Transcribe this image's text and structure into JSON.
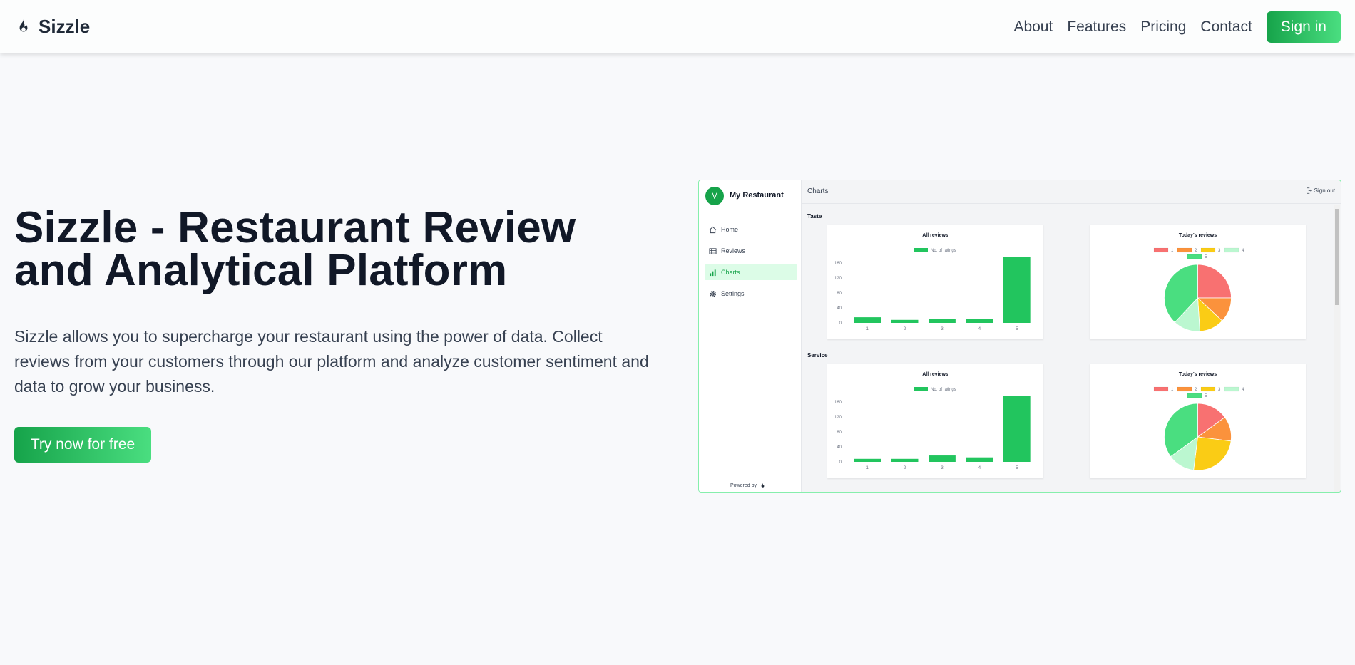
{
  "brand": {
    "name": "Sizzle"
  },
  "nav": {
    "links": [
      "About",
      "Features",
      "Pricing",
      "Contact"
    ],
    "signin_label": "Sign in"
  },
  "hero": {
    "title_line1": "Sizzle - Restaurant Review",
    "title_line2": "and Analytical Platform",
    "description": "Sizzle allows you to supercharge your restaurant using the power of data. Collect reviews from your customers through our platform and analyze customer sentiment and data to grow your business.",
    "cta_label": "Try now for free"
  },
  "preview": {
    "avatar_letter": "M",
    "restaurant_name": "My Restaurant",
    "menu": [
      "Home",
      "Reviews",
      "Charts",
      "Settings"
    ],
    "active_menu": "Charts",
    "powered_by": "Powered by",
    "header_title": "Charts",
    "signout_label": "Sign out",
    "sections": [
      "Taste",
      "Service"
    ],
    "card_titles": {
      "bar": "All reviews",
      "pie": "Today's reviews"
    },
    "bar_legend": "No. of ratings",
    "pie_legend": [
      "1",
      "2",
      "3",
      "4",
      "5"
    ]
  },
  "colors": {
    "accent": "#22c55e",
    "pie": [
      "#f87171",
      "#fb923c",
      "#facc15",
      "#bbf7d0",
      "#4ade80"
    ]
  },
  "chart_data": [
    {
      "type": "bar",
      "title": "All reviews",
      "section": "Taste",
      "categories": [
        "1",
        "2",
        "3",
        "4",
        "5"
      ],
      "series": [
        {
          "name": "No. of ratings",
          "values": [
            15,
            8,
            10,
            10,
            175
          ]
        }
      ],
      "yticks": [
        0,
        40,
        80,
        120,
        160
      ],
      "ylim": [
        0,
        175
      ]
    },
    {
      "type": "pie",
      "title": "Today's reviews",
      "section": "Taste",
      "labels": [
        "1",
        "2",
        "3",
        "4",
        "5"
      ],
      "values": [
        25,
        12,
        12,
        13,
        38
      ]
    },
    {
      "type": "bar",
      "title": "All reviews",
      "section": "Service",
      "categories": [
        "1",
        "2",
        "3",
        "4",
        "5"
      ],
      "series": [
        {
          "name": "No. of ratings",
          "values": [
            8,
            8,
            17,
            12,
            175
          ]
        }
      ],
      "yticks": [
        0,
        40,
        80,
        120,
        160
      ],
      "ylim": [
        0,
        175
      ]
    },
    {
      "type": "pie",
      "title": "Today's reviews",
      "section": "Service",
      "labels": [
        "1",
        "2",
        "3",
        "4",
        "5"
      ],
      "values": [
        15,
        12,
        25,
        13,
        35
      ]
    }
  ]
}
